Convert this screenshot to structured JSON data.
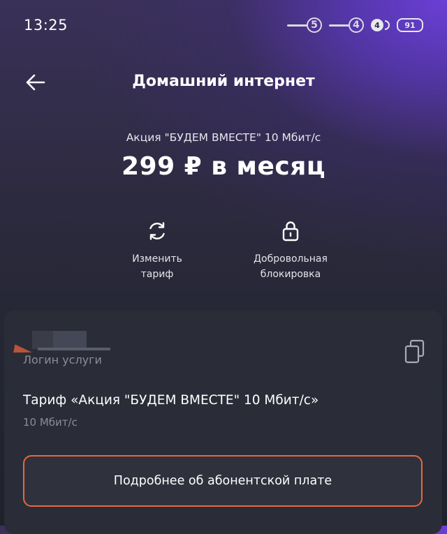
{
  "status_bar": {
    "time": "13:25",
    "sim1": "5",
    "sim2": "4",
    "sound": "4",
    "battery": "91"
  },
  "header": {
    "back_icon": "arrow-left-icon",
    "title": "Домашний интернет"
  },
  "tariff": {
    "caption": "Акция \"БУДЕМ ВМЕСТЕ\" 10 Мбит/с",
    "price": "299 ₽ в месяц"
  },
  "actions": {
    "change": {
      "icon": "refresh-icon",
      "label": "Изменить\nтариф"
    },
    "block": {
      "icon": "lock-icon",
      "label": "Добровольная\nблокировка"
    }
  },
  "card": {
    "login_label": "Логин услуги",
    "copy_icon": "copy-icon",
    "tariff_name": "Тариф «Акция \"БУДЕМ ВМЕСТЕ\" 10 Мбит/с»",
    "tariff_speed": "10 Мбит/с",
    "details_button": "Подробнее об абонентской плате"
  },
  "colors": {
    "accent_border": "#e8673f",
    "card_bg": "#2a2d37",
    "gradient_purple": "#6a3fd6"
  }
}
